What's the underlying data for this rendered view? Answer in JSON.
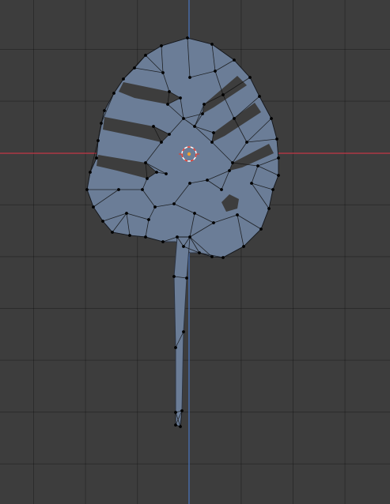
{
  "viewport": {
    "mode": "edit-mode",
    "background_color": "#3d3d3d",
    "grid_color": "#2f2f2f",
    "x_axis_color": "#c6394a",
    "y_axis_color": "#4b78c2",
    "mesh_fill_color": "#6b7d97",
    "mesh_dark_color": "#56657d",
    "wire_color": "#111111",
    "vertex_color": "#000000",
    "cursor_ring_color": "#ffffff",
    "cursor_accent_color": "#e83a2c"
  },
  "object": {
    "name_icon": "monstera-leaf-mesh",
    "origin_icon": "object-origin-dot",
    "cursor_icon": "3d-cursor-icon"
  }
}
